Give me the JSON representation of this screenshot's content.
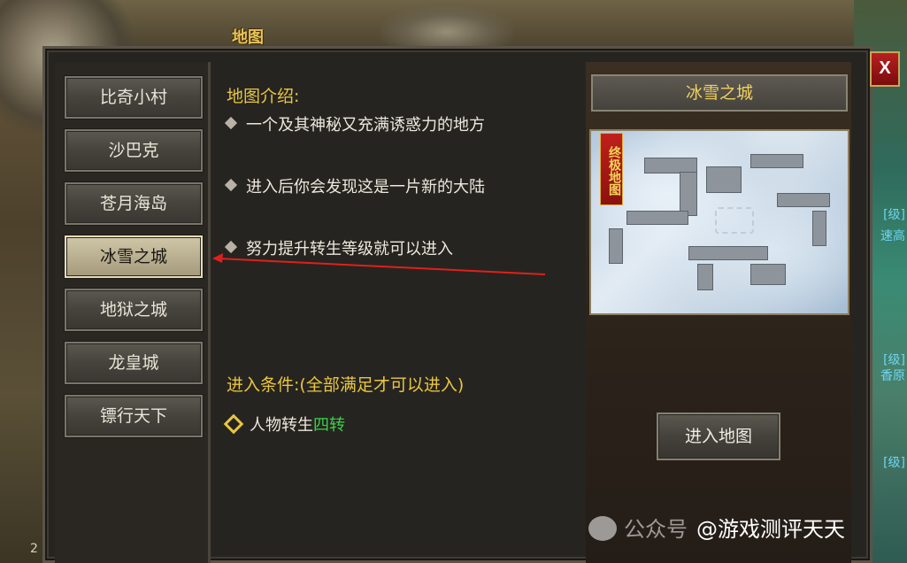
{
  "window": {
    "title": "地图",
    "close_label": "X"
  },
  "nav": {
    "items": [
      {
        "label": "比奇小村",
        "active": false
      },
      {
        "label": "沙巴克",
        "active": false
      },
      {
        "label": "苍月海岛",
        "active": false
      },
      {
        "label": "冰雪之城",
        "active": true
      },
      {
        "label": "地狱之城",
        "active": false
      },
      {
        "label": "龙皇城",
        "active": false
      },
      {
        "label": "镖行天下",
        "active": false
      }
    ]
  },
  "intro": {
    "heading": "地图介绍:",
    "items": [
      "一个及其神秘又充满诱惑力的地方",
      "进入后你会发现这是一片新的大陆",
      "努力提升转生等级就可以进入"
    ]
  },
  "conditions": {
    "heading": "进入条件:(全部满足才可以进入)",
    "items": [
      {
        "prefix": "人物转生",
        "value": "四转",
        "value_color": "#3ad24a"
      }
    ]
  },
  "map_preview": {
    "name": "冰雪之城",
    "badge": "终极地图",
    "enter_label": "进入地图"
  },
  "background_text": {
    "right_1": "[级]",
    "right_2": "速高",
    "right_3": "[级]",
    "right_4": "[级]",
    "right_5": "香原",
    "left_number": "2"
  },
  "watermark": {
    "faded_text": "公众号",
    "text": "@游戏测评天天"
  }
}
